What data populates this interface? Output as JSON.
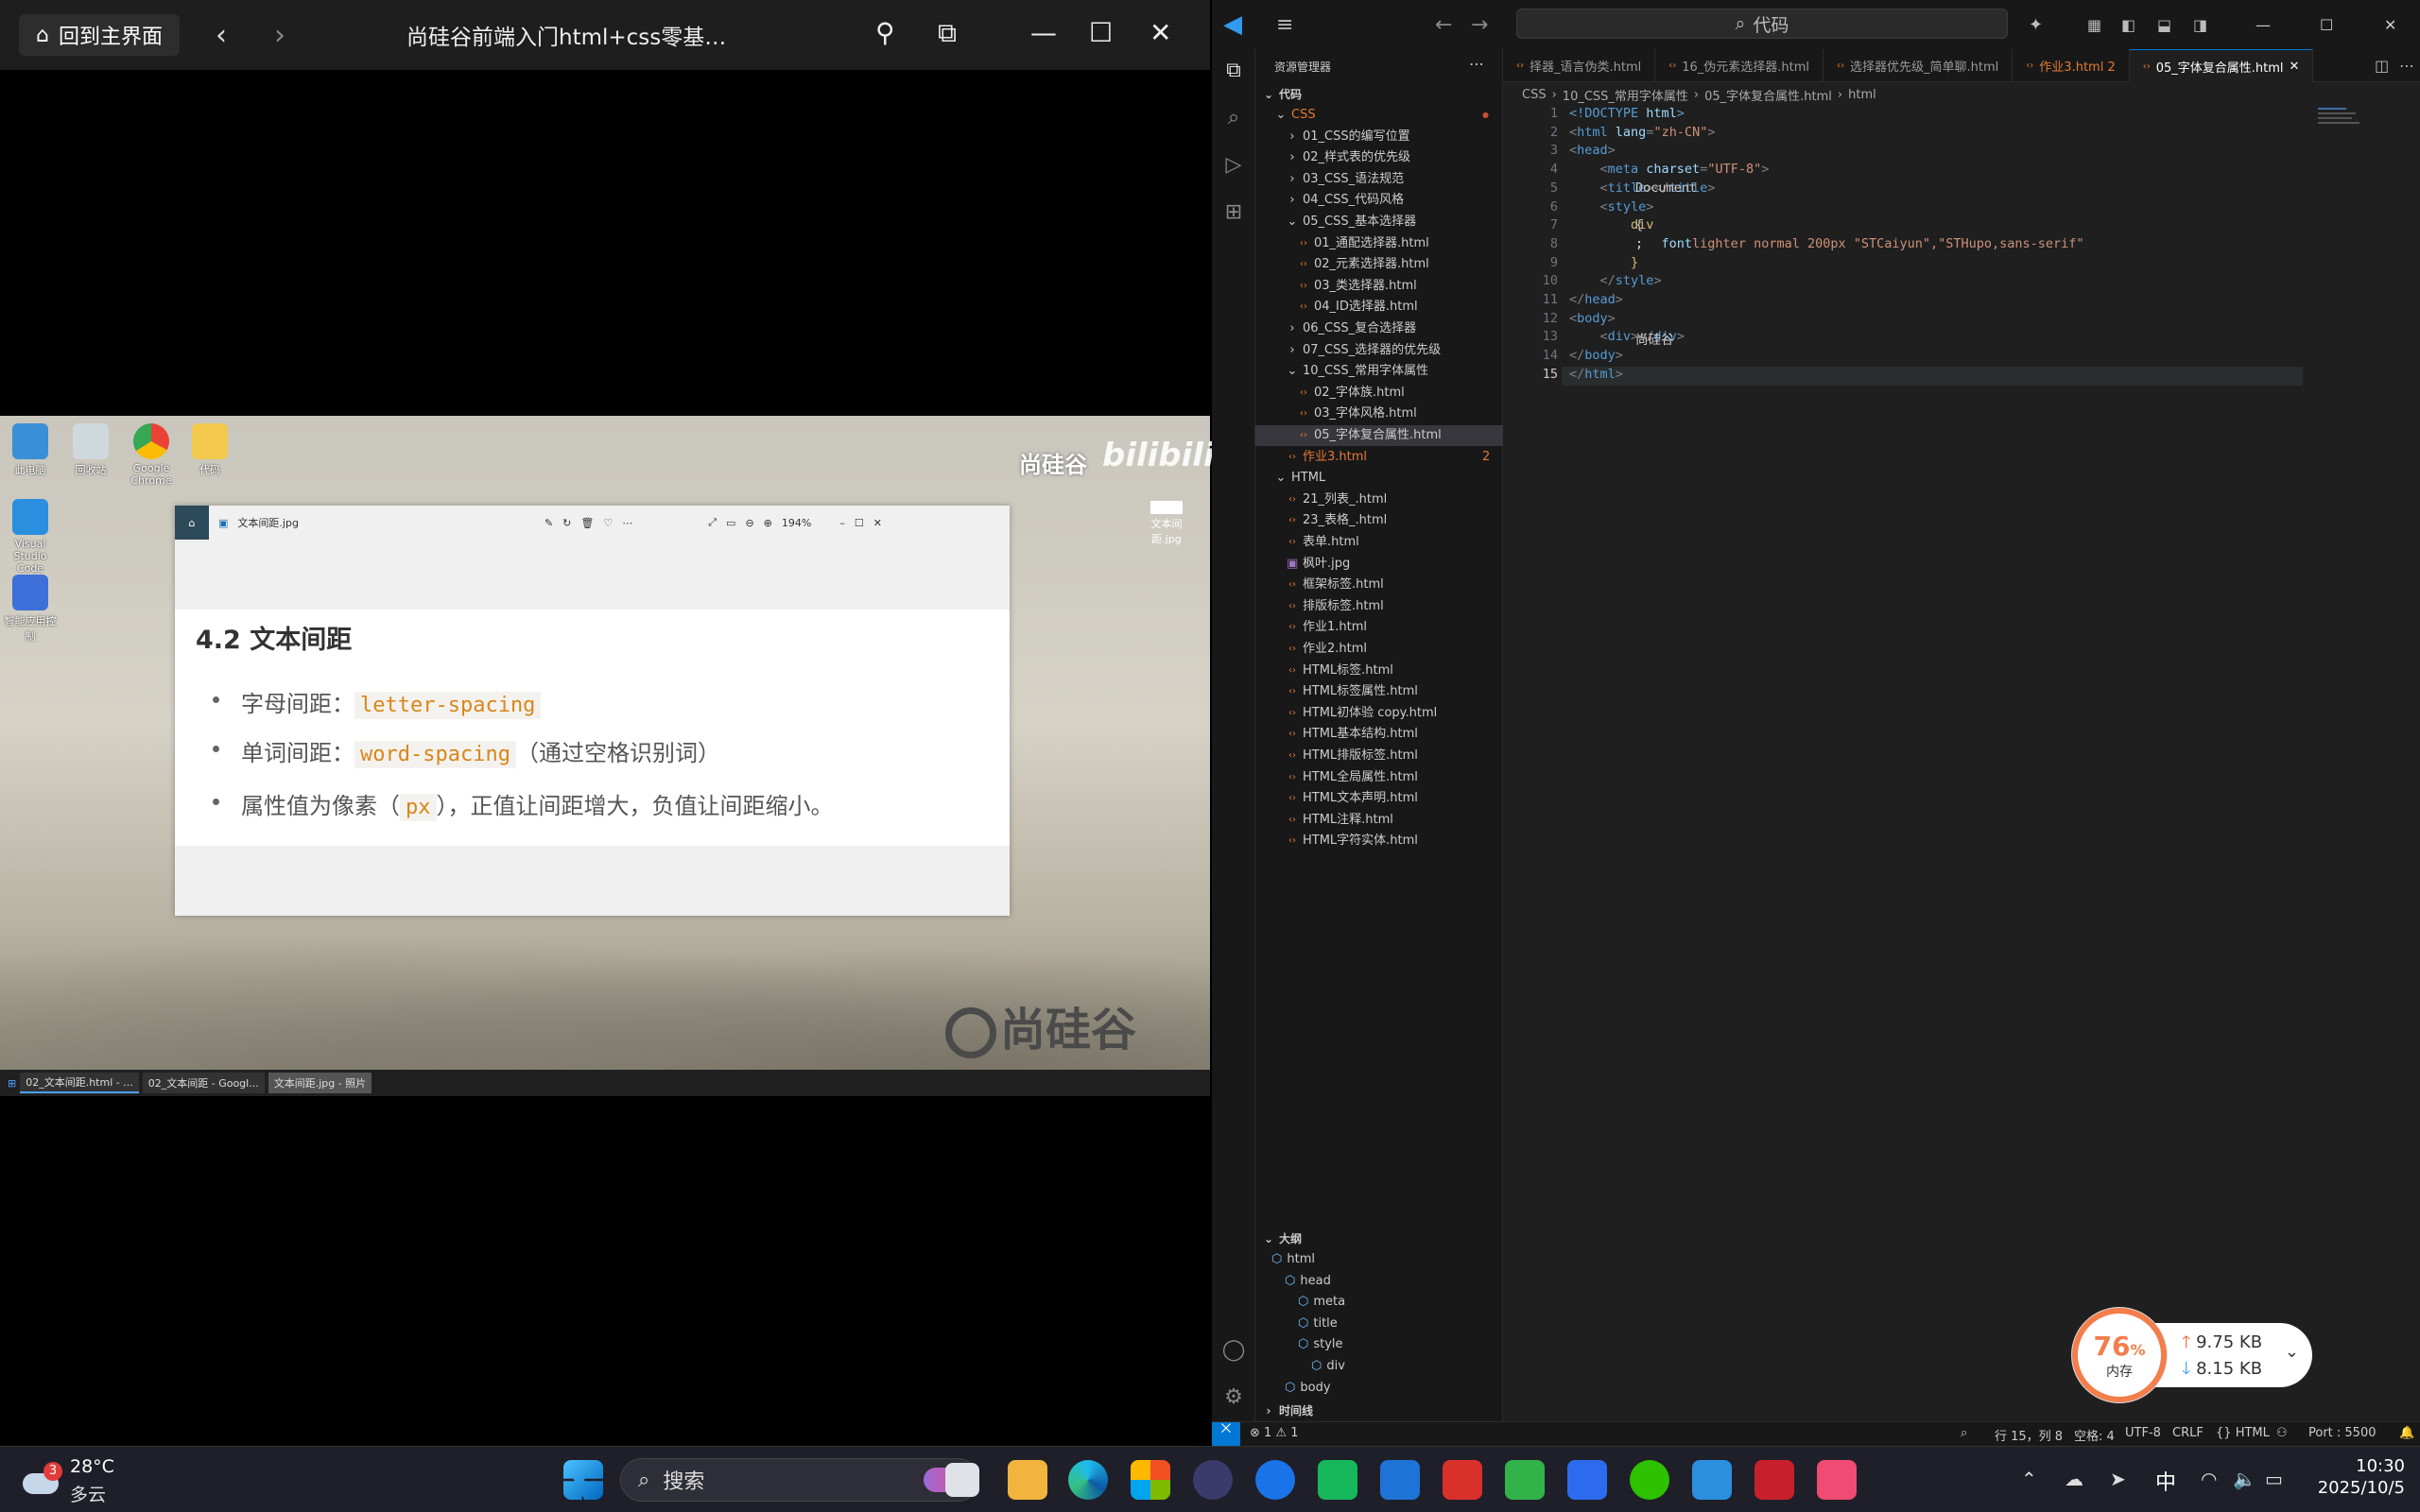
{
  "player": {
    "home_label": "回到主界面",
    "title": "尚硅谷前端入门html+css零基础教…"
  },
  "desktop": {
    "icons": [
      {
        "label": "此电脑"
      },
      {
        "label": "回收站"
      },
      {
        "label": "Google Chrome"
      },
      {
        "label": "代码"
      },
      {
        "label": "Visual Studio Code"
      },
      {
        "label": "智能应用控制"
      }
    ],
    "watermark": "尚硅谷",
    "bili": "bilibili",
    "brand": "尚硅谷",
    "right_file": "文本间距.jpg"
  },
  "viewer": {
    "title": "文本间距.jpg",
    "zoom": "194%",
    "heading_num": "4.2",
    "heading": "文本间距",
    "b1_label": "字母间距：",
    "b1_code": "letter-spacing",
    "b2_label": "单词间距：",
    "b2_code": "word-spacing",
    "b2_note": "（通过空格识别词）",
    "b3_a": "属性值为像素（",
    "b3_code": "px",
    "b3_b": "），正值让间距增大，负值让间距缩小。"
  },
  "vtaskbar": {
    "items": [
      "02_文本间距.html - ...",
      "02_文本间距 - Googl...",
      "文本间距.jpg - 照片"
    ]
  },
  "vscode": {
    "search": "代码",
    "explorer_title": "资源管理器",
    "root": "代码",
    "tree": [
      {
        "label": "CSS",
        "type": "folder-open",
        "depth": 0,
        "hi": true
      },
      {
        "label": "01_CSS的编写位置",
        "type": "folder",
        "depth": 1
      },
      {
        "label": "02_样式表的优先级",
        "type": "folder",
        "depth": 1
      },
      {
        "label": "03_CSS_语法规范",
        "type": "folder",
        "depth": 1
      },
      {
        "label": "04_CSS_代码风格",
        "type": "folder",
        "depth": 1
      },
      {
        "label": "05_CSS_基本选择器",
        "type": "folder-open",
        "depth": 1
      },
      {
        "label": "01_通配选择器.html",
        "type": "html",
        "depth": 2
      },
      {
        "label": "02_元素选择器.html",
        "type": "html",
        "depth": 2
      },
      {
        "label": "03_类选择器.html",
        "type": "html",
        "depth": 2
      },
      {
        "label": "04_ID选择器.html",
        "type": "html",
        "depth": 2
      },
      {
        "label": "06_CSS_复合选择器",
        "type": "folder",
        "depth": 1
      },
      {
        "label": "07_CSS_选择器的优先级",
        "type": "folder",
        "depth": 1
      },
      {
        "label": "10_CSS_常用字体属性",
        "type": "folder-open",
        "depth": 1
      },
      {
        "label": "02_字体族.html",
        "type": "html",
        "depth": 2
      },
      {
        "label": "03_字体风格.html",
        "type": "html",
        "depth": 2
      },
      {
        "label": "05_字体复合属性.html",
        "type": "html",
        "depth": 2,
        "selected": true
      },
      {
        "label": "作业3.html",
        "type": "html",
        "depth": 1,
        "hi": true,
        "badge": "2"
      },
      {
        "label": "HTML",
        "type": "folder-open",
        "depth": 0
      },
      {
        "label": "21_列表_.html",
        "type": "html",
        "depth": 1
      },
      {
        "label": "23_表格_.html",
        "type": "html",
        "depth": 1
      },
      {
        "label": "表单.html",
        "type": "html",
        "depth": 1
      },
      {
        "label": "枫叶.jpg",
        "type": "img",
        "depth": 1
      },
      {
        "label": "框架标签.html",
        "type": "html",
        "depth": 1
      },
      {
        "label": "排版标签.html",
        "type": "html",
        "depth": 1
      },
      {
        "label": "作业1.html",
        "type": "html",
        "depth": 1
      },
      {
        "label": "作业2.html",
        "type": "html",
        "depth": 1
      },
      {
        "label": "HTML标签.html",
        "type": "html",
        "depth": 1
      },
      {
        "label": "HTML标签属性.html",
        "type": "html",
        "depth": 1
      },
      {
        "label": "HTML初体验 copy.html",
        "type": "html",
        "depth": 1
      },
      {
        "label": "HTML基本结构.html",
        "type": "html",
        "depth": 1
      },
      {
        "label": "HTML排版标签.html",
        "type": "html",
        "depth": 1
      },
      {
        "label": "HTML全局属性.html",
        "type": "html",
        "depth": 1
      },
      {
        "label": "HTML文本声明.html",
        "type": "html",
        "depth": 1
      },
      {
        "label": "HTML注释.html",
        "type": "html",
        "depth": 1
      },
      {
        "label": "HTML字符实体.html",
        "type": "html",
        "depth": 1
      }
    ],
    "outline_title": "大纲",
    "outline": [
      {
        "label": "html",
        "depth": 0
      },
      {
        "label": "head",
        "depth": 1
      },
      {
        "label": "meta",
        "depth": 2
      },
      {
        "label": "title",
        "depth": 2
      },
      {
        "label": "style",
        "depth": 2
      },
      {
        "label": "div",
        "depth": 3
      },
      {
        "label": "body",
        "depth": 1
      }
    ],
    "timeline_title": "时间线",
    "tabs": [
      {
        "label": "择器_语言伪类.html"
      },
      {
        "label": "16_伪元素选择器.html"
      },
      {
        "label": "选择器优先级_简单聊.html"
      },
      {
        "label": "作业3.html 2",
        "error": true
      },
      {
        "label": "05_字体复合属性.html",
        "active": true
      }
    ],
    "crumbs": [
      "CSS",
      "10_CSS_常用字体属性",
      "05_字体复合属性.html",
      "html"
    ],
    "status": {
      "errors": "⊗ 1 ⚠ 1",
      "pos": "行 15，列 8",
      "spaces": "空格: 4",
      "enc": "UTF-8",
      "eol": "CRLF",
      "lang": "HTML",
      "port": "Port : 5500"
    }
  },
  "memory": {
    "percent": "76",
    "unit": "%",
    "label": "内存",
    "up": "9.75 KB",
    "down": "8.15 KB"
  },
  "taskbar": {
    "weather_badge": "3",
    "temp": "28°C",
    "cond": "多云",
    "search": "搜索",
    "ime": "中",
    "time": "10:30",
    "date": "2025/10/5"
  }
}
